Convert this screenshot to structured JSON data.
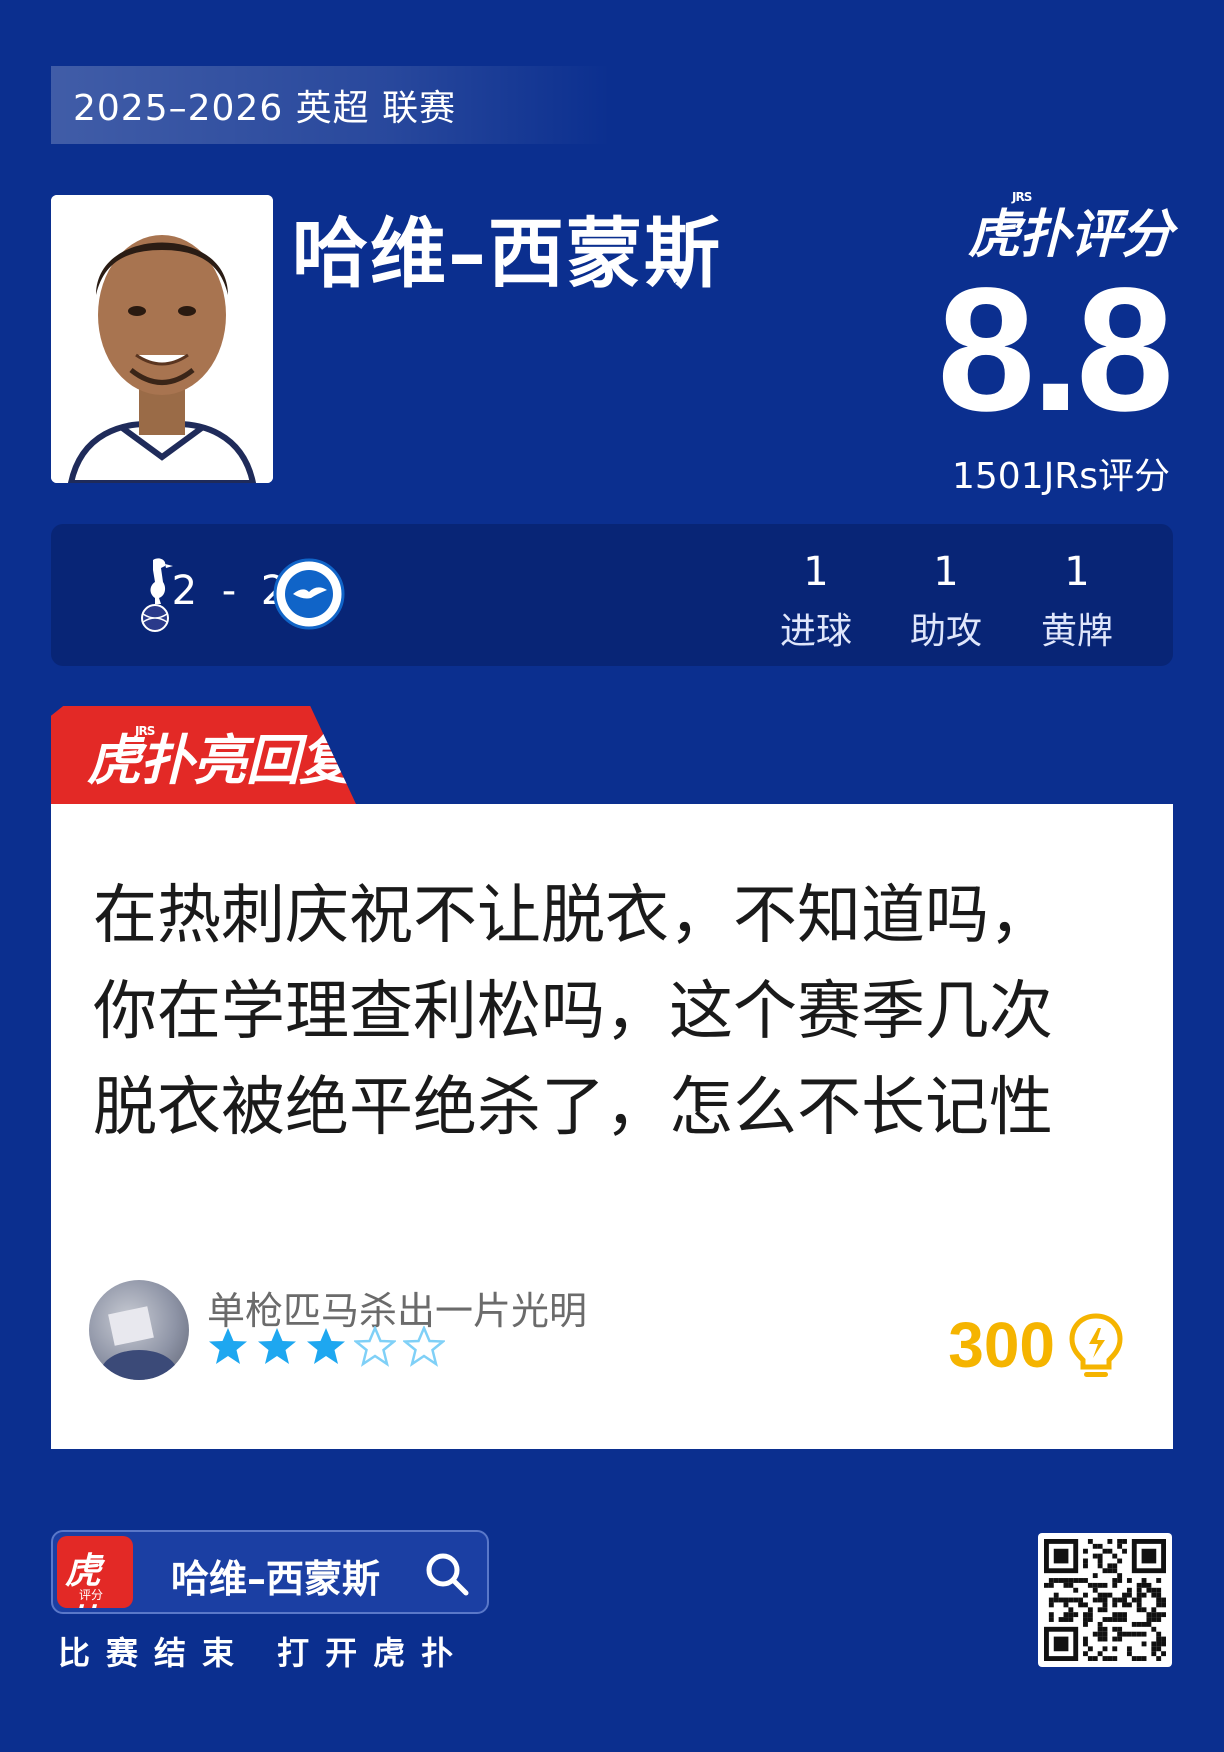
{
  "season": {
    "label": "2025–2026 英超 联赛"
  },
  "player": {
    "name": "哈维–西蒙斯"
  },
  "brand": {
    "logo_text": "虎扑评分",
    "logo_tag": "JRS"
  },
  "rating": {
    "score": "8.8",
    "count_label": "1501JRs评分"
  },
  "match": {
    "home_team_icon": "tottenham-crest",
    "away_team_icon": "brighton-crest",
    "score": "2 - 2",
    "stats": [
      {
        "value": "1",
        "label": "进球"
      },
      {
        "value": "1",
        "label": "助攻"
      },
      {
        "value": "1",
        "label": "黄牌"
      }
    ]
  },
  "highlight": {
    "tab_label": "虎扑亮回复",
    "tab_tag": "JRS"
  },
  "comment": {
    "lines": [
      "在热刺庆祝不让脱衣，不知道吗，",
      "你在学理查利松吗，这个赛季几次",
      "脱衣被绝平绝杀了，怎么不长记性"
    ],
    "username": "单枪匹马杀出一片光明",
    "stars_rating": 3,
    "stars_total": 5,
    "likes": "300",
    "like_icon": "lightbulb-icon"
  },
  "footer": {
    "app_icon_text": "虎扑",
    "app_icon_sub": "评分",
    "search_text": "哈维–西蒙斯",
    "cta": "比赛结束 打开虎扑"
  },
  "colors": {
    "background": "#0b2f8f",
    "panel": "#082576",
    "highlight_red": "#e32926",
    "like_gold": "#f5b400",
    "star_blue": "#1ea7f0"
  }
}
